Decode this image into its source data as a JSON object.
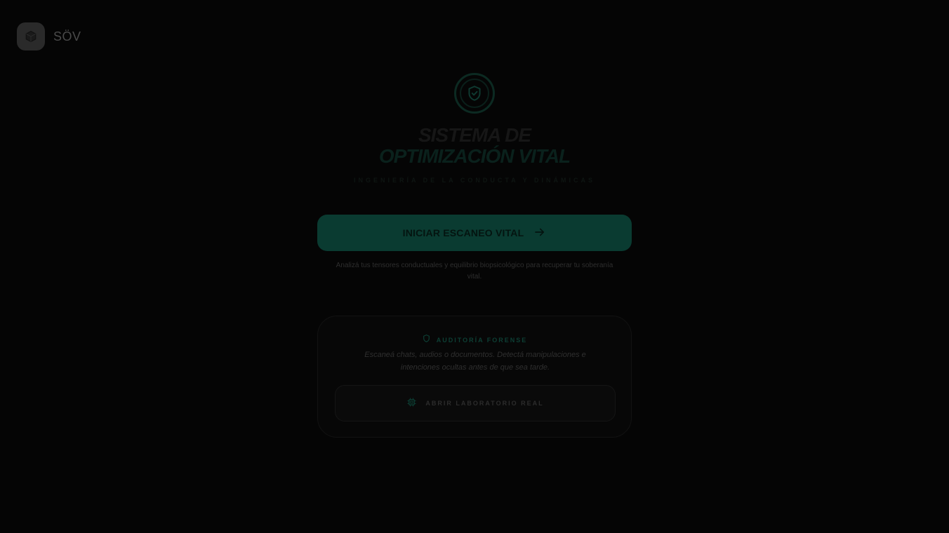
{
  "brand": {
    "name": "SÖV",
    "icon": "cube-icon"
  },
  "hero": {
    "icon": "shield-check-icon",
    "title_line1": "SISTEMA DE",
    "title_line2": "OPTIMIZACIÓN VITAL",
    "tagline": "INGENIERÍA DE LA CONDUCTA Y DINÁMICAS"
  },
  "cta": {
    "label": "INICIAR ESCANEO VITAL",
    "icon": "arrow-right-icon",
    "description": "Analizá tus tensores conductuales y equilibrio biopsicológico para recuperar tu soberanía vital."
  },
  "forensic": {
    "icon": "shield-icon",
    "title": "AUDITORÍA FORENSE",
    "description": "Escaneá chats, audios o documentos. Detectá manipulaciones e intenciones ocultas antes de que sea tarde.",
    "button_icon": "cpu-chip-icon",
    "button_label": "ABRIR LABORATORIO REAL"
  },
  "colors": {
    "background": "#050505",
    "accent": "#0a3b31",
    "accent_text": "#0d3f34"
  }
}
